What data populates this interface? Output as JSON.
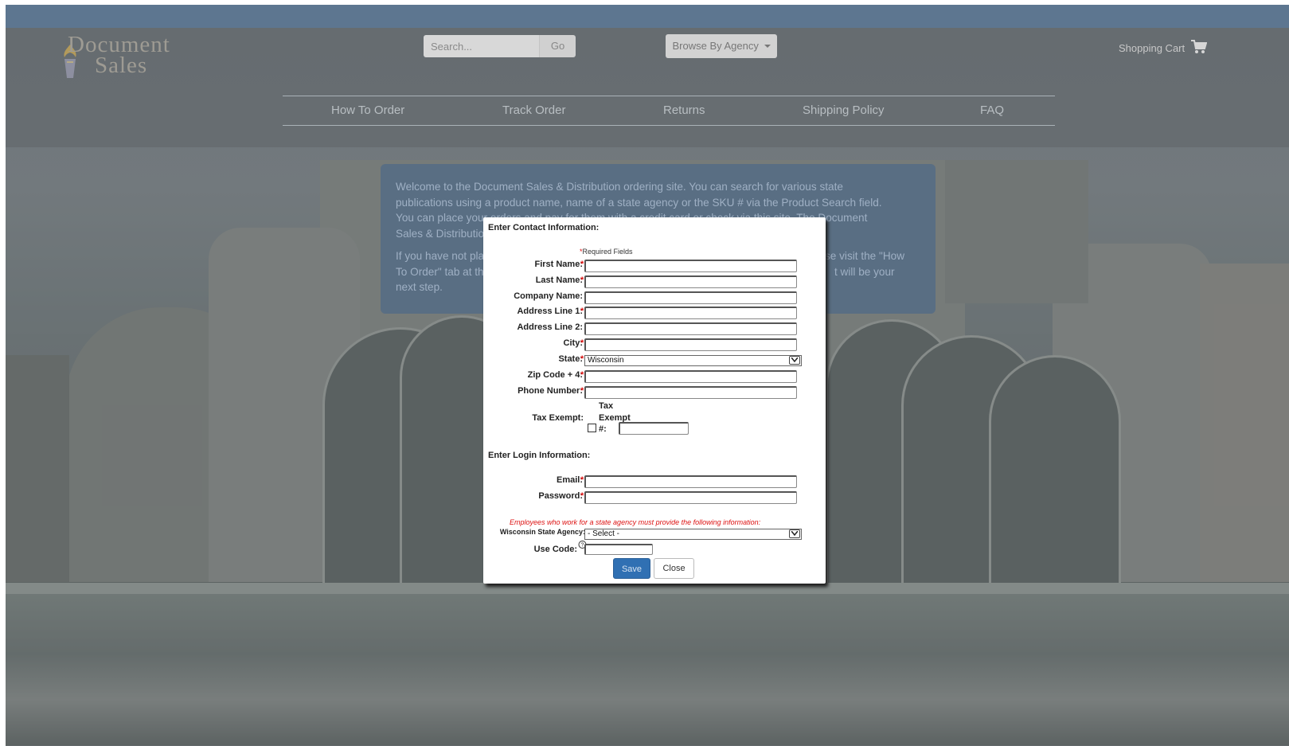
{
  "header": {
    "logo_line1": "Document",
    "logo_line2": "Sales",
    "search_placeholder": "Search...",
    "go_label": "Go",
    "browse_label": "Browse By Agency",
    "cart_label": "Shopping Cart"
  },
  "nav": {
    "items": [
      "How To Order",
      "Track Order",
      "Returns",
      "Shipping Policy",
      "FAQ"
    ]
  },
  "welcome": {
    "para1_line1": "Welcome to the Document Sales & Distribution ordering site.  You can search for various state",
    "para1_line2": "publications using a product name, name of a state agency or the SKU # via the Product Search field.",
    "para1_line3": "You can place your orders and pay for them with a credit card or check via this site.  The Document",
    "para1_line4": "Sales & Distributio",
    "para2_line1_a": "If you have not pla",
    "para2_line1_b": "se visit the \"How",
    "para2_line2_a": "To Order\" tab at th",
    "para2_line2_b": "t will be your",
    "para2_line3": "next step."
  },
  "modal": {
    "contact_title": "Enter Contact Information:",
    "required_note": "Required Fields",
    "required_star": "*",
    "fields": {
      "first_name": "First Name:",
      "last_name": "Last Name:",
      "company": "Company Name:",
      "address1": "Address Line 1:",
      "address2": "Address Line 2:",
      "city": "City:",
      "state": "State:",
      "zip": "Zip Code + 4:",
      "phone": "Phone Number:"
    },
    "state_value": "Wisconsin",
    "tax_exempt_label": "Tax Exempt:",
    "tax_exempt_num_line1": "Tax",
    "tax_exempt_num_line2": "Exempt",
    "tax_exempt_num_line3": "#:",
    "login_title": "Enter Login Information:",
    "email_label": "Email:",
    "password_label": "Password:",
    "employee_note": "Employees who work for a state agency must provide the following information:",
    "agency_label": "Wisconsin State Agency:",
    "agency_value": "- Select -",
    "use_code_label": "Use Code:",
    "save_label": "Save",
    "close_label": "Close"
  }
}
